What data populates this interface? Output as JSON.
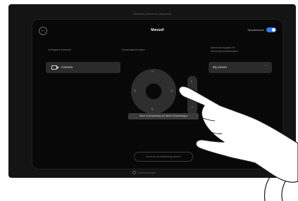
{
  "device": {
    "top_label": "Skaidrių kameros valdymas"
  },
  "panel": {
    "title": "Manuell",
    "speaker_track_label": "Speakertrack",
    "speaker_track_enabled": true
  },
  "sections": {
    "available_cameras": "Verfügbare Kameras",
    "camera_controls": "Kamerasteuerungen",
    "presets": "Kameraverfügbare Fit Kameravoreinstellungen"
  },
  "camera_button": {
    "icon": "video-camera-icon",
    "label": "Camera"
  },
  "preset_button": {
    "label": "My preset",
    "more": "···"
  },
  "joystick": {
    "up": "^",
    "down": "v",
    "left": "<",
    "right": ">"
  },
  "zoom": {
    "plus": "+",
    "minus": "−"
  },
  "tooltip": {
    "text": "Neue Voreinstellung mit diesen Einstellungen"
  },
  "bottom": {
    "button_label": "Kamera-Voreinstellung sichern"
  },
  "footer": {
    "hint": "Voreinstellungen"
  },
  "colors": {
    "accent": "#2f7bf3",
    "panel_background": "#080808",
    "button_background": "#2b2b2b"
  }
}
